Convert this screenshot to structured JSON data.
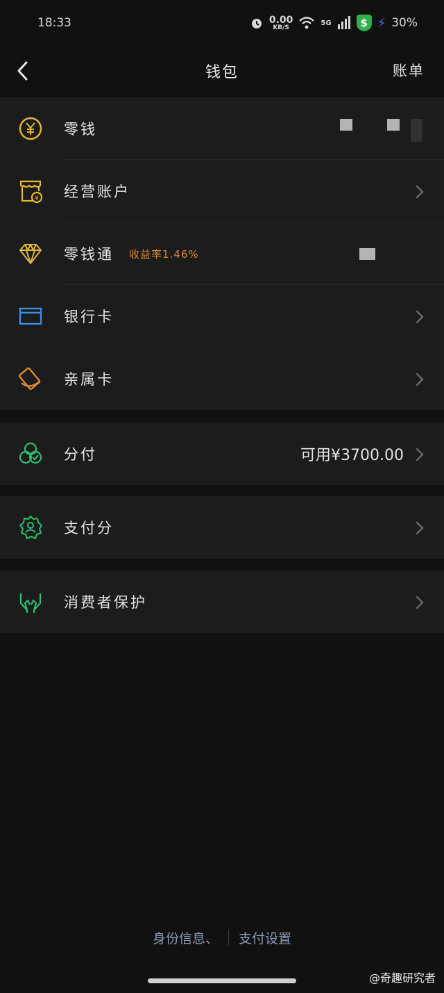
{
  "status": {
    "time": "18:33",
    "speed_value": "0.00",
    "speed_unit": "KB/S",
    "network": "5G",
    "battery": "30%"
  },
  "nav": {
    "title": "钱包",
    "right_action": "账单"
  },
  "group1": [
    {
      "label": "零钱",
      "icon": "yuan-coin-icon"
    },
    {
      "label": "经营账户",
      "icon": "shop-icon"
    },
    {
      "label": "零钱通",
      "icon": "diamond-icon",
      "badge": "收益率1.46%"
    },
    {
      "label": "银行卡",
      "icon": "bank-card-icon"
    },
    {
      "label": "亲属卡",
      "icon": "family-card-icon"
    }
  ],
  "group2": {
    "label": "分付",
    "icon": "fenfu-icon",
    "value": "可用¥3700.00"
  },
  "group3": {
    "label": "支付分",
    "icon": "payscore-icon"
  },
  "group4": {
    "label": "消费者保护",
    "icon": "hands-icon"
  },
  "footer": {
    "identity": "身份信息、",
    "settings": "支付设置"
  },
  "watermark": "@奇趣研究者",
  "colors": {
    "background": "#111111",
    "card": "#1c1c1c",
    "yellow_icon": "#e3b82c",
    "green_icon": "#29c070",
    "blue_icon": "#3d8fe0",
    "orange_icon": "#d98a35",
    "badge": "#d98a35",
    "footer_link": "#8a9bb8"
  }
}
